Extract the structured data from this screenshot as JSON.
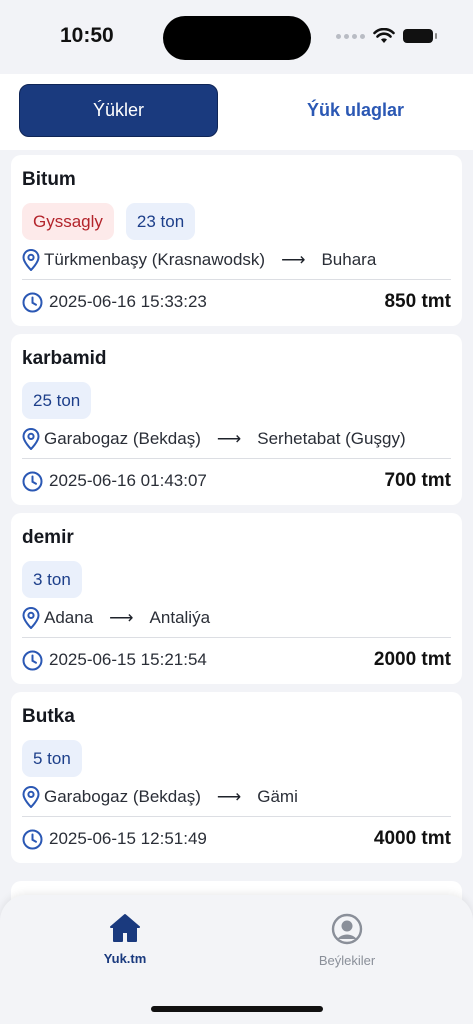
{
  "status": {
    "time": "10:50"
  },
  "tabs": [
    {
      "label": "Ýükler",
      "active": true
    },
    {
      "label": "Ýük ulaglar",
      "active": false
    }
  ],
  "cards": [
    {
      "title": "Bitum",
      "urgent": "Gyssagly",
      "weight": "23 ton",
      "from": "Türkmenbaşy (Krasnawodsk)",
      "to": "Buhara",
      "datetime": "2025-06-16 15:33:23",
      "price": "850 tmt"
    },
    {
      "title": "karbamid",
      "urgent": "",
      "weight": "25 ton",
      "from": "Garabogaz (Bekdaş)",
      "to": "Serhetabat (Guşgy)",
      "datetime": "2025-06-16 01:43:07",
      "price": "700 tmt"
    },
    {
      "title": "demir",
      "urgent": "",
      "weight": "3 ton",
      "from": "Adana",
      "to": "Antaliýa",
      "datetime": "2025-06-15 15:21:54",
      "price": "2000 tmt"
    },
    {
      "title": "Butka",
      "urgent": "",
      "weight": "5 ton",
      "from": "Garabogaz (Bekdaş)",
      "to": "Gämi",
      "datetime": "2025-06-15 12:51:49",
      "price": "4000 tmt"
    }
  ],
  "arrow": "⟶",
  "nav": {
    "home_label": "Yuk.tm",
    "profile_label": "Beýlekiler"
  },
  "colors": {
    "primary": "#1a3a7e",
    "urgent_bg": "#fdeaea",
    "urgent_text": "#b3242b",
    "weight_bg": "#eaf0fb"
  },
  "icons": {
    "location": "location-pin-icon",
    "time": "clock-icon",
    "home": "home-icon",
    "profile": "user-circle-icon"
  }
}
